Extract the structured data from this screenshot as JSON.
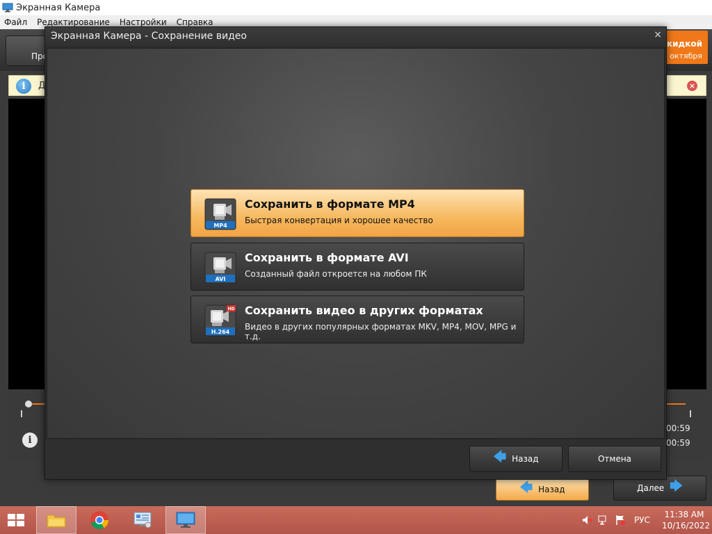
{
  "app": {
    "title": "Экранная Камера",
    "menu": [
      "Файл",
      "Редактирование",
      "Настройки",
      "Справка"
    ],
    "toolbar_left_label": "Про",
    "promo_line1": "кидкой",
    "promo_line2": "октября",
    "info_banner_text": "Д",
    "time_total": "00:59",
    "time_end": "00:59",
    "back_label": "Назад",
    "next_label": "Далее"
  },
  "dialog": {
    "title": "Экранная Камера - Сохранение видео",
    "close_glyph": "×",
    "options": [
      {
        "title": "Сохранить в формате MP4",
        "desc": "Быстрая конвертация и хорошее качество",
        "badge": "MP4",
        "selected": true
      },
      {
        "title": "Сохранить в формате AVI",
        "desc": "Созданный файл откроется на любом ПК",
        "badge": "AVI",
        "selected": false
      },
      {
        "title": "Сохранить видео в других форматах",
        "desc": "Видео в других популярных форматах MKV, MP4, MOV, MPG и т.д.",
        "badge": "H.264",
        "hd_badge": "HD",
        "selected": false
      }
    ],
    "back_label": "Назад",
    "cancel_label": "Отмена"
  },
  "taskbar": {
    "lang": "РУС",
    "time": "11:38 AM",
    "date": "10/16/2022"
  },
  "colors": {
    "accent_orange": "#f2a445",
    "arrow_blue": "#3fa0e8",
    "taskbar": "#b2554a"
  }
}
